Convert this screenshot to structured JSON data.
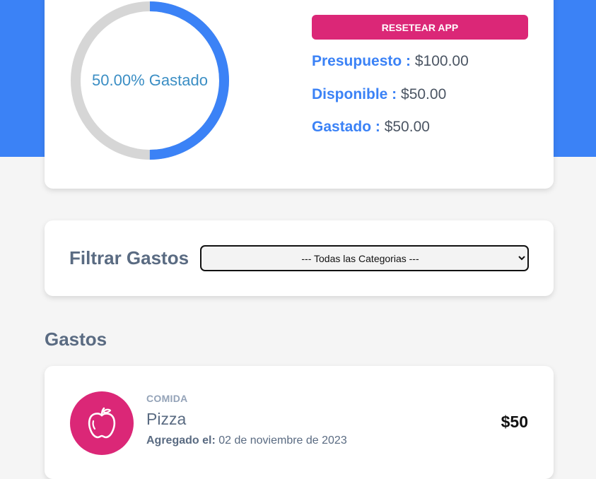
{
  "budget": {
    "progress_label": "50.00% Gastado",
    "progress_fraction": 0.5,
    "reset_label": "RESETEAR APP",
    "presupuesto_key": "Presupuesto :",
    "presupuesto_value": "$100.00",
    "disponible_key": "Disponible :",
    "disponible_value": "$50.00",
    "gastado_key": "Gastado :",
    "gastado_value": "$50.00"
  },
  "filter": {
    "label": "Filtrar Gastos",
    "selected": "--- Todas las Categorias ---"
  },
  "expenses": {
    "title": "Gastos",
    "items": [
      {
        "category": "COMIDA",
        "name": "Pizza",
        "date_key": "Agregado el:",
        "date_value": "02 de noviembre de 2023",
        "amount": "$50",
        "icon": "apple-icon"
      }
    ]
  },
  "colors": {
    "primary": "#3b82f6",
    "accent": "#db2777",
    "track": "#d6d6d6",
    "background": "#f5f5f5"
  }
}
